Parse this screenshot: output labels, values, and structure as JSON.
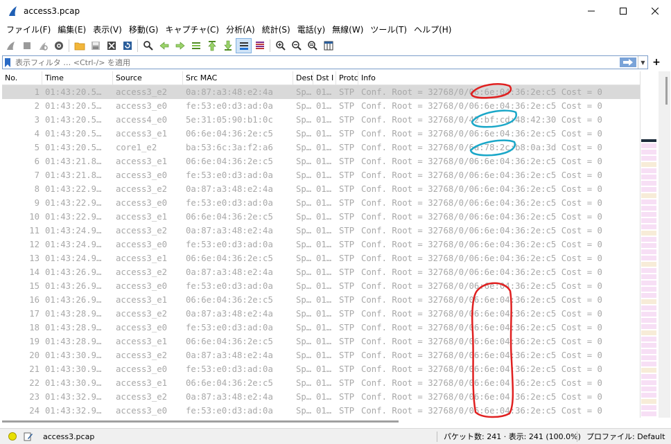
{
  "window": {
    "title": "access3.pcap",
    "controls": [
      "minimize",
      "maximize",
      "close"
    ]
  },
  "menu": [
    "ファイル(F)",
    "編集(E)",
    "表示(V)",
    "移動(G)",
    "キャプチャ(C)",
    "分析(A)",
    "統計(S)",
    "電話(y)",
    "無線(W)",
    "ツール(T)",
    "ヘルプ(H)"
  ],
  "toolbar": {
    "icons": [
      "start-capture-icon",
      "stop-capture-icon",
      "restart-capture-icon",
      "capture-options-icon",
      "open-file-icon",
      "save-file-icon",
      "close-file-icon",
      "reload-file-icon",
      "find-packet-icon",
      "go-back-icon",
      "go-forward-icon",
      "go-to-packet-icon",
      "go-first-icon",
      "go-last-icon",
      "auto-scroll-icon",
      "colorize-icon",
      "zoom-in-icon",
      "zoom-out-icon",
      "zoom-normal-icon",
      "resize-columns-icon"
    ]
  },
  "filter": {
    "placeholder": "表示フィルタ … <Ctrl-/> を適用"
  },
  "columns": [
    "No.",
    "Time",
    "Source",
    "Src MAC",
    "Dest",
    "Dst I",
    "Protc",
    "Info"
  ],
  "rows": [
    {
      "no": "1",
      "time": "01:43:20.5…",
      "src": "access3_e2",
      "smac": "0a:87:a3:48:e2:4a",
      "dest": "Sp…",
      "dsti": "01…",
      "proto": "STP",
      "info": "Conf. Root = 32768/0/06:6e:04:36:2e:c5   Cost = 0"
    },
    {
      "no": "2",
      "time": "01:43:20.5…",
      "src": "access3_e0",
      "smac": "fe:53:e0:d3:ad:0a",
      "dest": "Sp…",
      "dsti": "01…",
      "proto": "STP",
      "info": "Conf. Root = 32768/0/06:6e:04:36:2e:c5   Cost = 0"
    },
    {
      "no": "3",
      "time": "01:43:20.5…",
      "src": "access4_e0",
      "smac": "5e:31:05:90:b1:0c",
      "dest": "Sp…",
      "dsti": "01…",
      "proto": "STP",
      "info": "Conf. Root = 32768/0/42:bf:cd:48:42:30   Cost = 0"
    },
    {
      "no": "4",
      "time": "01:43:20.5…",
      "src": "access3_e1",
      "smac": "06:6e:04:36:2e:c5",
      "dest": "Sp…",
      "dsti": "01…",
      "proto": "STP",
      "info": "Conf. Root = 32768/0/06:6e:04:36:2e:c5   Cost = 0"
    },
    {
      "no": "5",
      "time": "01:43:20.5…",
      "src": "core1_e2",
      "smac": "ba:53:6c:3a:f2:a6",
      "dest": "Sp…",
      "dsti": "01…",
      "proto": "STP",
      "info": "Conf. Root = 32768/0/6a:78:2c:b8:0a:3d   Cost = 0"
    },
    {
      "no": "6",
      "time": "01:43:21.8…",
      "src": "access3_e1",
      "smac": "06:6e:04:36:2e:c5",
      "dest": "Sp…",
      "dsti": "01…",
      "proto": "STP",
      "info": "Conf. Root = 32768/0/06:6e:04:36:2e:c5   Cost = 0"
    },
    {
      "no": "7",
      "time": "01:43:21.8…",
      "src": "access3_e0",
      "smac": "fe:53:e0:d3:ad:0a",
      "dest": "Sp…",
      "dsti": "01…",
      "proto": "STP",
      "info": "Conf. Root = 32768/0/06:6e:04:36:2e:c5   Cost = 0"
    },
    {
      "no": "8",
      "time": "01:43:22.9…",
      "src": "access3_e2",
      "smac": "0a:87:a3:48:e2:4a",
      "dest": "Sp…",
      "dsti": "01…",
      "proto": "STP",
      "info": "Conf. Root = 32768/0/06:6e:04:36:2e:c5   Cost = 0"
    },
    {
      "no": "9",
      "time": "01:43:22.9…",
      "src": "access3_e0",
      "smac": "fe:53:e0:d3:ad:0a",
      "dest": "Sp…",
      "dsti": "01…",
      "proto": "STP",
      "info": "Conf. Root = 32768/0/06:6e:04:36:2e:c5   Cost = 0"
    },
    {
      "no": "10",
      "time": "01:43:22.9…",
      "src": "access3_e1",
      "smac": "06:6e:04:36:2e:c5",
      "dest": "Sp…",
      "dsti": "01…",
      "proto": "STP",
      "info": "Conf. Root = 32768/0/06:6e:04:36:2e:c5   Cost = 0"
    },
    {
      "no": "11",
      "time": "01:43:24.9…",
      "src": "access3_e2",
      "smac": "0a:87:a3:48:e2:4a",
      "dest": "Sp…",
      "dsti": "01…",
      "proto": "STP",
      "info": "Conf. Root = 32768/0/06:6e:04:36:2e:c5   Cost = 0"
    },
    {
      "no": "12",
      "time": "01:43:24.9…",
      "src": "access3_e0",
      "smac": "fe:53:e0:d3:ad:0a",
      "dest": "Sp…",
      "dsti": "01…",
      "proto": "STP",
      "info": "Conf. Root = 32768/0/06:6e:04:36:2e:c5   Cost = 0"
    },
    {
      "no": "13",
      "time": "01:43:24.9…",
      "src": "access3_e1",
      "smac": "06:6e:04:36:2e:c5",
      "dest": "Sp…",
      "dsti": "01…",
      "proto": "STP",
      "info": "Conf. Root = 32768/0/06:6e:04:36:2e:c5   Cost = 0"
    },
    {
      "no": "14",
      "time": "01:43:26.9…",
      "src": "access3_e2",
      "smac": "0a:87:a3:48:e2:4a",
      "dest": "Sp…",
      "dsti": "01…",
      "proto": "STP",
      "info": "Conf. Root = 32768/0/06:6e:04:36:2e:c5   Cost = 0"
    },
    {
      "no": "15",
      "time": "01:43:26.9…",
      "src": "access3_e0",
      "smac": "fe:53:e0:d3:ad:0a",
      "dest": "Sp…",
      "dsti": "01…",
      "proto": "STP",
      "info": "Conf. Root = 32768/0/06:6e:04:36:2e:c5   Cost = 0"
    },
    {
      "no": "16",
      "time": "01:43:26.9…",
      "src": "access3_e1",
      "smac": "06:6e:04:36:2e:c5",
      "dest": "Sp…",
      "dsti": "01…",
      "proto": "STP",
      "info": "Conf. Root = 32768/0/06:6e:04:36:2e:c5   Cost = 0"
    },
    {
      "no": "17",
      "time": "01:43:28.9…",
      "src": "access3_e2",
      "smac": "0a:87:a3:48:e2:4a",
      "dest": "Sp…",
      "dsti": "01…",
      "proto": "STP",
      "info": "Conf. Root = 32768/0/06:6e:04:36:2e:c5   Cost = 0"
    },
    {
      "no": "18",
      "time": "01:43:28.9…",
      "src": "access3_e0",
      "smac": "fe:53:e0:d3:ad:0a",
      "dest": "Sp…",
      "dsti": "01…",
      "proto": "STP",
      "info": "Conf. Root = 32768/0/06:6e:04:36:2e:c5   Cost = 0"
    },
    {
      "no": "19",
      "time": "01:43:28.9…",
      "src": "access3_e1",
      "smac": "06:6e:04:36:2e:c5",
      "dest": "Sp…",
      "dsti": "01…",
      "proto": "STP",
      "info": "Conf. Root = 32768/0/06:6e:04:36:2e:c5   Cost = 0"
    },
    {
      "no": "20",
      "time": "01:43:30.9…",
      "src": "access3_e2",
      "smac": "0a:87:a3:48:e2:4a",
      "dest": "Sp…",
      "dsti": "01…",
      "proto": "STP",
      "info": "Conf. Root = 32768/0/06:6e:04:36:2e:c5   Cost = 0"
    },
    {
      "no": "21",
      "time": "01:43:30.9…",
      "src": "access3_e0",
      "smac": "fe:53:e0:d3:ad:0a",
      "dest": "Sp…",
      "dsti": "01…",
      "proto": "STP",
      "info": "Conf. Root = 32768/0/06:6e:04:36:2e:c5   Cost = 0"
    },
    {
      "no": "22",
      "time": "01:43:30.9…",
      "src": "access3_e1",
      "smac": "06:6e:04:36:2e:c5",
      "dest": "Sp…",
      "dsti": "01…",
      "proto": "STP",
      "info": "Conf. Root = 32768/0/06:6e:04:36:2e:c5   Cost = 0"
    },
    {
      "no": "23",
      "time": "01:43:32.9…",
      "src": "access3_e2",
      "smac": "0a:87:a3:48:e2:4a",
      "dest": "Sp…",
      "dsti": "01…",
      "proto": "STP",
      "info": "Conf. Root = 32768/0/06:6e:04:36:2e:c5   Cost = 0"
    },
    {
      "no": "24",
      "time": "01:43:32.9…",
      "src": "access3_e0",
      "smac": "fe:53:e0:d3:ad:0a",
      "dest": "Sp…",
      "dsti": "01…",
      "proto": "STP",
      "info": "Conf. Root = 32768/0/06:6e:04:36:2e:c5   Cost = 0"
    }
  ],
  "selected_row": 0,
  "colors": {
    "row_text": "#a8a8a8",
    "selected_bg": "#d9d9d9",
    "minimap_stp": "#f7dff5",
    "minimap_other": "#f7ecd8",
    "annotation_red": "#e02020",
    "annotation_cyan": "#1aa7c8"
  },
  "status": {
    "file": "access3.pcap",
    "stats": "パケット数: 241 · 表示: 241 (100.0%)",
    "profile": "プロファイル: Default"
  }
}
